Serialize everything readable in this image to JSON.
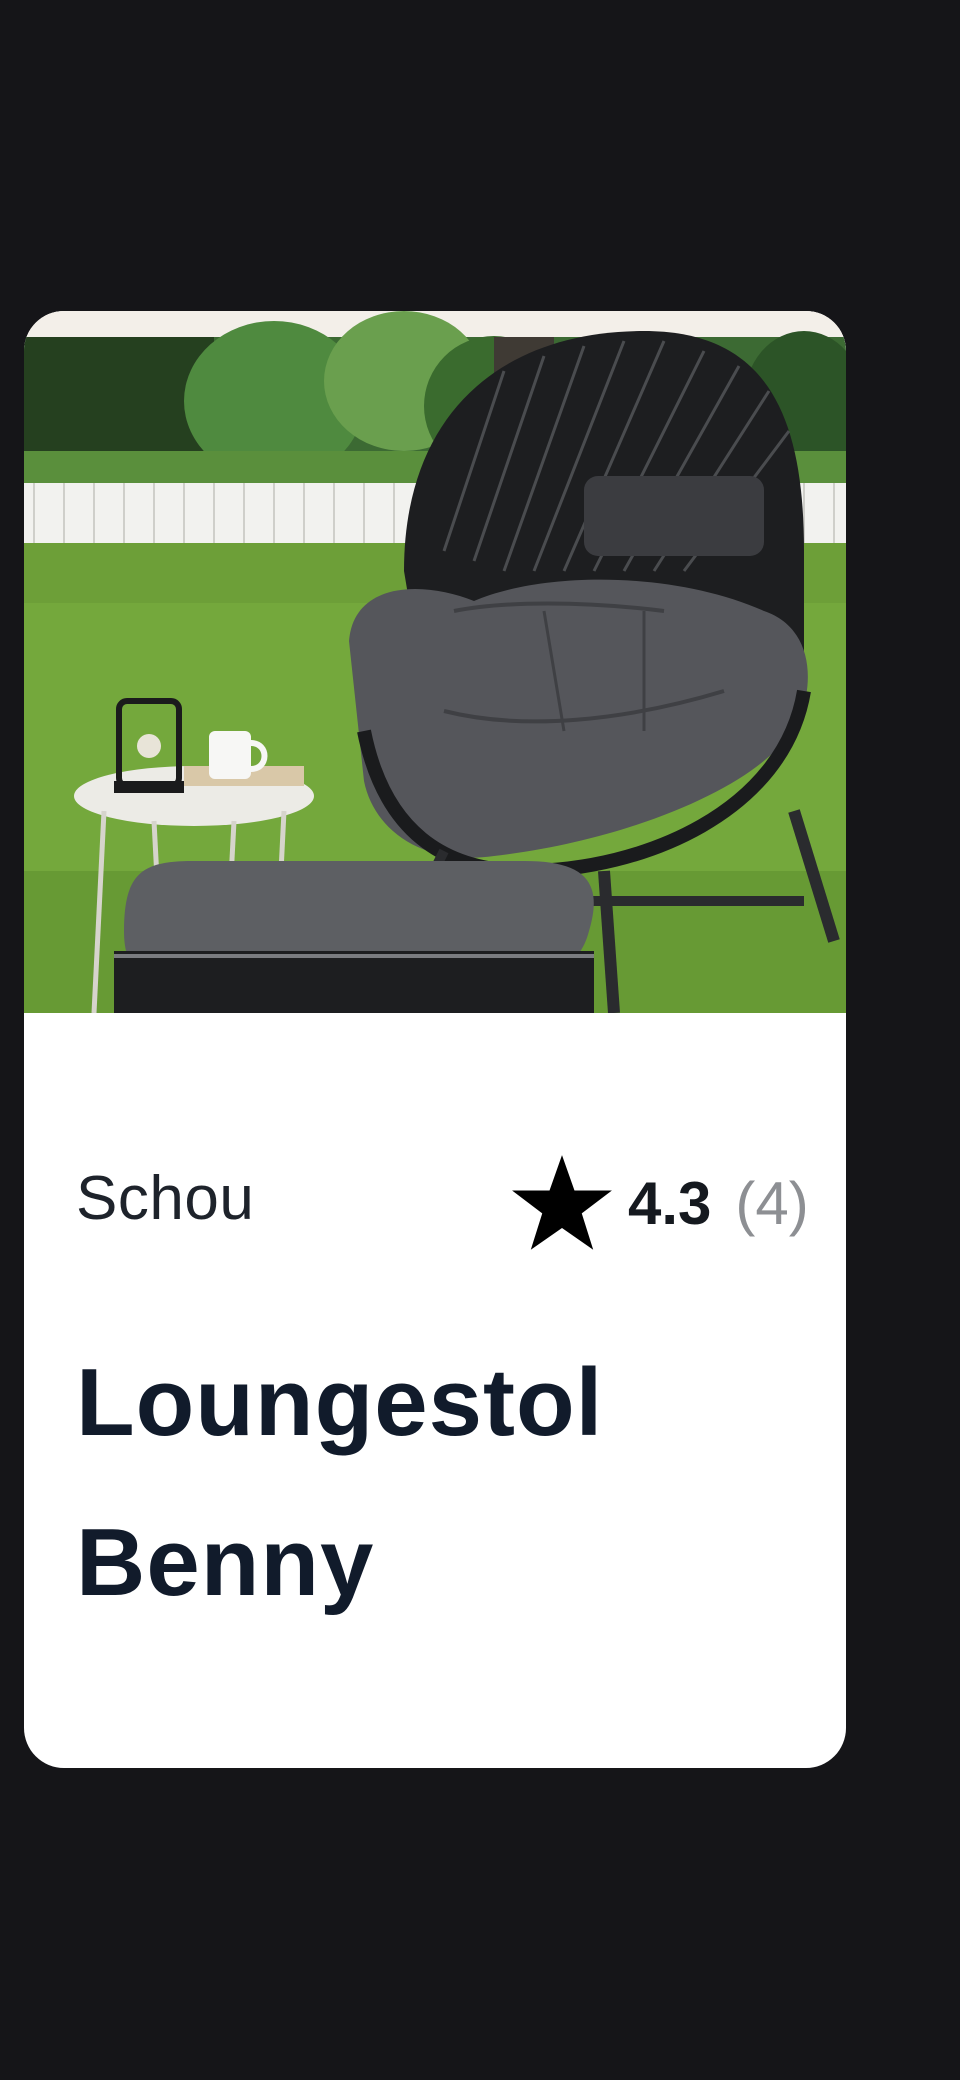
{
  "product": {
    "brand": "Schou",
    "rating": "4.3",
    "rating_count": "(4)",
    "name": "Loungestol Benny"
  },
  "icons": {
    "rating": "star-icon"
  },
  "colors": {
    "background": "#151518",
    "card": "#ffffff",
    "text_dark": "#111b2b",
    "text_muted": "#8d8f93"
  }
}
